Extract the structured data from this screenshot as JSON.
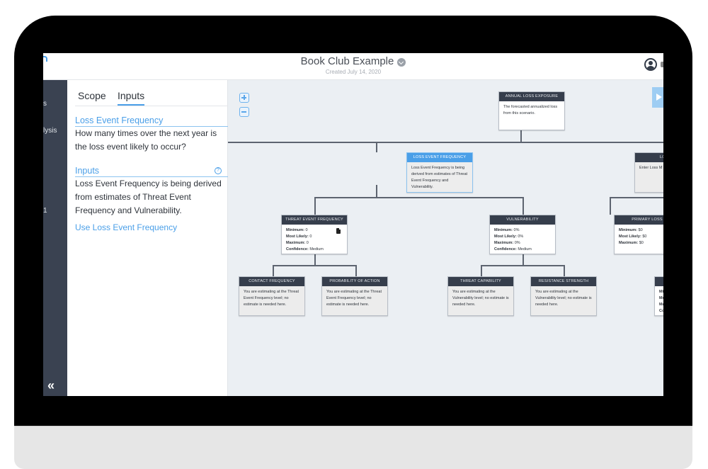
{
  "header": {
    "title": "Book Club Example",
    "subtitle": "Created July 14, 2020"
  },
  "sidebar": {
    "items": [
      "s",
      "lysis",
      "1"
    ],
    "collapse_label": "«"
  },
  "panel": {
    "tabs": [
      {
        "label": "Scope",
        "active": false
      },
      {
        "label": "Inputs",
        "active": true
      }
    ],
    "section1_title": "Loss Event Frequency",
    "section1_text": "How many times over the next year is the loss event likely to occur?",
    "section2_title": "Inputs",
    "help_icon": "?",
    "section2_text": "Loss Event Frequency is being derived from estimates of Threat Event Frequency and Vulnerability.",
    "link_label": "Use Loss Event Frequency"
  },
  "canvas": {
    "nodes": {
      "ale": {
        "title": "ANNUAL LOSS EXPOSURE",
        "text": "The forecasted annualized loss from this scenario."
      },
      "lef": {
        "title": "LOSS EVENT FREQUENCY",
        "text": "Loss Event Frequency is being derived from estimates of Threat Event Frequency and Vulnerability."
      },
      "lm": {
        "title": "LOSS M",
        "text": "Enter Loss M Primary and S"
      },
      "tef": {
        "title": "THREAT EVENT FREQUENCY",
        "min_label": "Minimum:",
        "min": "0",
        "ml_label": "Most Likely:",
        "ml": "0",
        "max_label": "Maximum:",
        "max": "0",
        "conf_label": "Confidence:",
        "conf": "Medium"
      },
      "vuln": {
        "title": "VULNERABILITY",
        "min_label": "Minimum:",
        "min": "0%",
        "ml_label": "Most Likely:",
        "ml": "0%",
        "max_label": "Maximum:",
        "max": "0%",
        "conf_label": "Confidence:",
        "conf": "Medium"
      },
      "pl": {
        "title": "PRIMARY LOSS",
        "min_label": "Minimum:",
        "min": "$0",
        "ml_label": "Most Likely:",
        "ml": "$0",
        "max_label": "Maximum:",
        "max": "$0"
      },
      "cf": {
        "title": "CONTACT FREQUENCY",
        "text": "You are estimating at the Threat Event Frequency level; no estimate is needed here."
      },
      "poa": {
        "title": "PROBABILITY OF ACTION",
        "text": "You are estimating at the Threat Event Frequency level; no estimate is needed here."
      },
      "tc": {
        "title": "THREAT CAPABILITY",
        "text": "You are estimating at the Vulnerability level; no estimate is needed here."
      },
      "rs": {
        "title": "RESISTANCE STRENGTH",
        "text": "You are estimating at the Vulnerability level; no estimate is needed here."
      },
      "partial": {
        "l1": "Mi",
        "l2": "Mo",
        "l3": "Ma",
        "l4": "Co"
      }
    }
  }
}
